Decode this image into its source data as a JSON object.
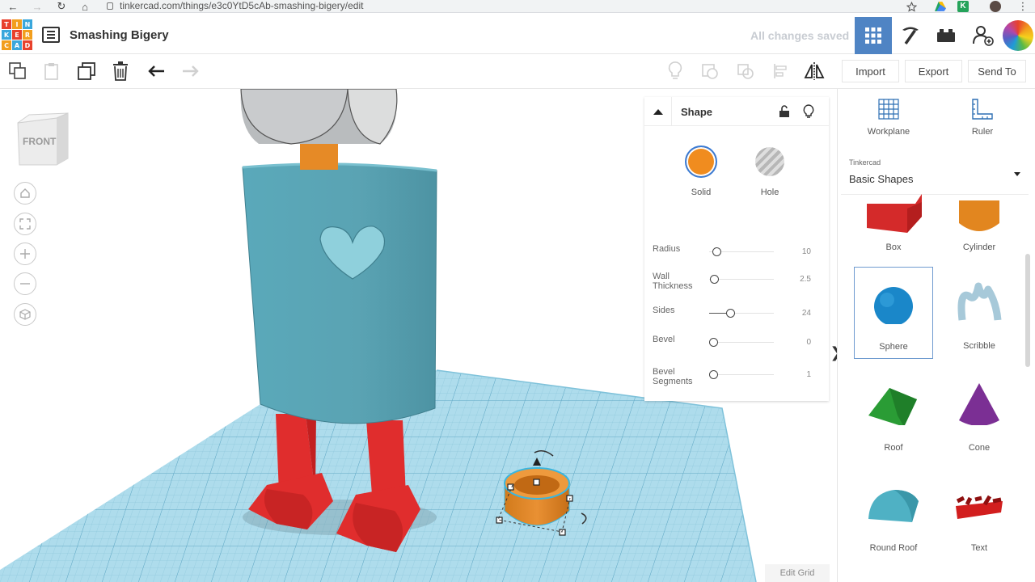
{
  "browser": {
    "url": "tinkercad.com/things/e3c0YtD5cAb-smashing-bigery/edit"
  },
  "app": {
    "logo_letters": [
      "T",
      "I",
      "N",
      "K",
      "E",
      "R",
      "C",
      "A",
      "D"
    ],
    "design_title": "Smashing Bigery",
    "save_status": "All changes saved"
  },
  "toolbar": {
    "import_label": "Import",
    "export_label": "Export",
    "send_to_label": "Send To"
  },
  "viewport": {
    "viewcube_label": "FRONT",
    "edit_grid_label": "Edit Grid"
  },
  "inspector": {
    "title": "Shape",
    "solid_label": "Solid",
    "hole_label": "Hole",
    "solid_color": "#f08c1f",
    "properties": [
      {
        "label": "Radius",
        "value": "10",
        "level": 0.05
      },
      {
        "label": "Wall Thickness",
        "value": "2.5",
        "level": 0.02
      },
      {
        "label": "Sides",
        "value": "24",
        "level": 0.3
      },
      {
        "label": "Bevel",
        "value": "0",
        "level": 0.0
      },
      {
        "label": "Bevel Segments",
        "value": "1",
        "level": 0.0
      }
    ]
  },
  "panel": {
    "workplane_label": "Workplane",
    "ruler_label": "Ruler",
    "library_category": "Tinkercad",
    "library_name": "Basic Shapes",
    "shapes": [
      {
        "label": "Box"
      },
      {
        "label": "Cylinder"
      },
      {
        "label": "Sphere"
      },
      {
        "label": "Scribble"
      },
      {
        "label": "Roof"
      },
      {
        "label": "Cone"
      },
      {
        "label": "Round Roof"
      },
      {
        "label": "Text"
      }
    ]
  },
  "colors": {
    "accent": "#4f84c4",
    "workplane": "#a8d8ea",
    "robot_body": "#5aa3b3",
    "robot_legs": "#e02d2d",
    "selected_cylinder": "#e68a26"
  }
}
